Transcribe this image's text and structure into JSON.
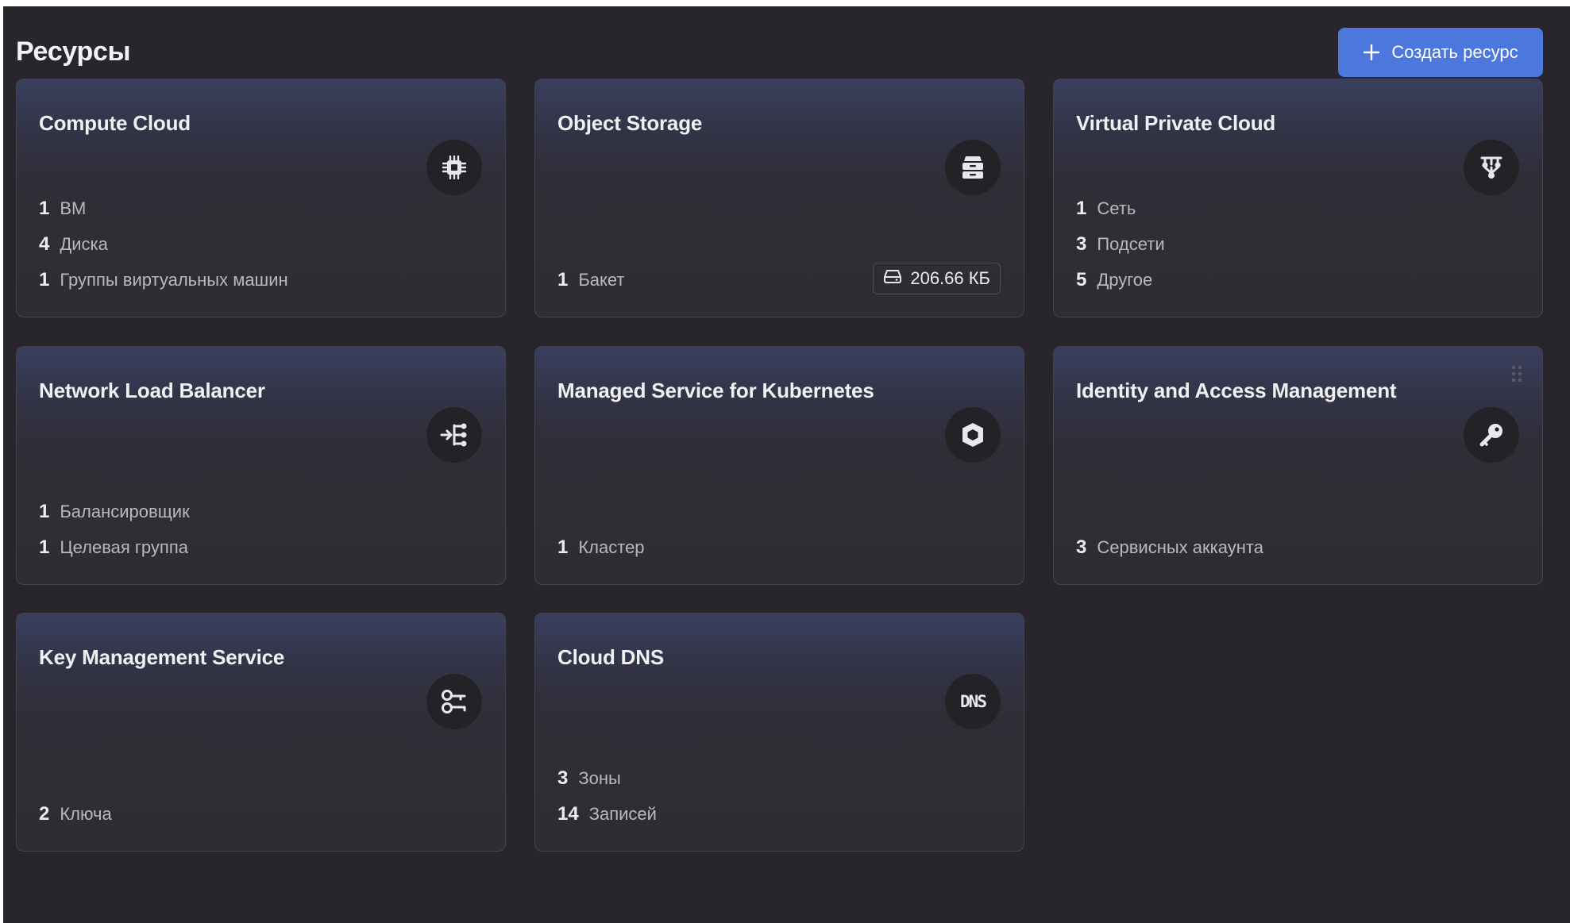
{
  "page": {
    "title": "Ресурсы",
    "create_button_label": "Создать ресурс"
  },
  "cards": [
    {
      "title": "Compute Cloud",
      "icon": "cpu-chip-icon",
      "stats": [
        {
          "count": "1",
          "label": "ВМ"
        },
        {
          "count": "4",
          "label": "Диска"
        },
        {
          "count": "1",
          "label": "Группы виртуальных машин"
        }
      ]
    },
    {
      "title": "Object Storage",
      "icon": "storage-archive-icon",
      "stats": [
        {
          "count": "1",
          "label": "Бакет"
        }
      ],
      "size_badge": "206.66 КБ"
    },
    {
      "title": "Virtual Private Cloud",
      "icon": "network-icon",
      "stats": [
        {
          "count": "1",
          "label": "Сеть"
        },
        {
          "count": "3",
          "label": "Подсети"
        },
        {
          "count": "5",
          "label": "Другое"
        }
      ]
    },
    {
      "title": "Network Load Balancer",
      "icon": "load-balancer-icon",
      "stats": [
        {
          "count": "1",
          "label": "Балансировщик"
        },
        {
          "count": "1",
          "label": "Целевая группа"
        }
      ]
    },
    {
      "title": "Managed Service for Kubernetes",
      "icon": "kubernetes-icon",
      "stats": [
        {
          "count": "1",
          "label": "Кластер"
        }
      ]
    },
    {
      "title": "Identity and Access Management",
      "icon": "key-icon",
      "stats": [
        {
          "count": "3",
          "label": "Сервисных аккаунта"
        }
      ]
    },
    {
      "title": "Key Management Service",
      "icon": "kms-key-icon",
      "stats": [
        {
          "count": "2",
          "label": "Ключа"
        }
      ]
    },
    {
      "title": "Cloud DNS",
      "icon": "dns-icon",
      "icon_text": "DNS",
      "stats": [
        {
          "count": "3",
          "label": "Зоны"
        },
        {
          "count": "14",
          "label": "Записей"
        }
      ]
    }
  ],
  "colors": {
    "background": "#28262c",
    "card_border": "#45434e",
    "accent_button": "#4c78dd",
    "icon_circle": "#232227",
    "text_primary": "#f0f0f2",
    "text_secondary": "#b9b8c0"
  }
}
